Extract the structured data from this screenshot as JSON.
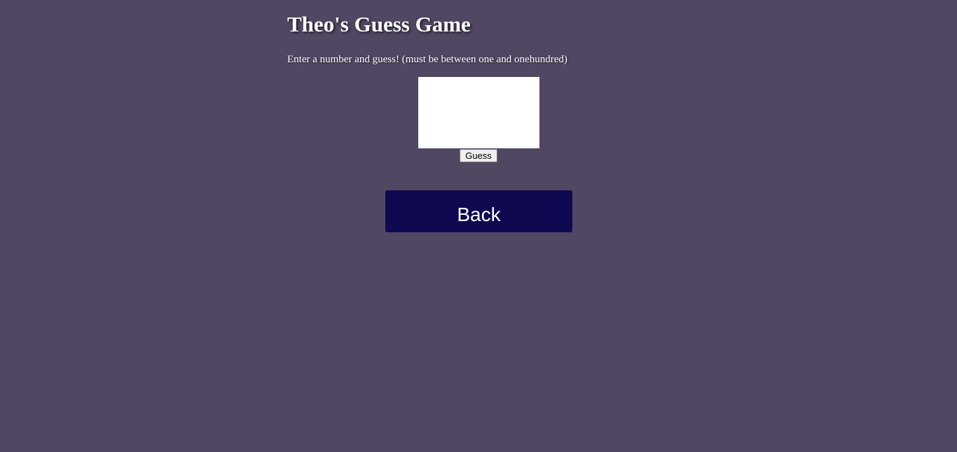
{
  "page": {
    "title": "Theo's Guess Game",
    "instructions": "Enter a number and guess! (must be between one and onehundred)"
  },
  "form": {
    "guess_value": "",
    "guess_placeholder": "",
    "guess_button_label": "Guess"
  },
  "nav": {
    "back_label": "Back"
  },
  "colors": {
    "background": "#514763",
    "back_button": "#0e0950",
    "text": "#ffffff"
  }
}
